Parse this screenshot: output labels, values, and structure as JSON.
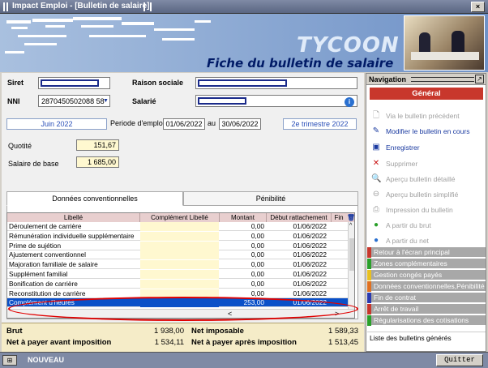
{
  "window": {
    "title": "Impact Emploi - [Bulletin de salaire]"
  },
  "banner": {
    "brand": "TYCOON",
    "heading": "Fiche du bulletin de salaire"
  },
  "form": {
    "siret_label": "Siret",
    "raison_label": "Raison sociale",
    "nni_label": "NNI",
    "nni_value": "2870450502088 58",
    "salarie_label": "Salarié",
    "period_month": "Juin 2022",
    "period_label": "Periode d'emploi",
    "period_start": "01/06/2022",
    "period_au": "au",
    "period_end": "30/06/2022",
    "quarter": "2e trimestre 2022",
    "quotite_label": "Quotité",
    "quotite_value": "151,67",
    "salaire_label": "Salaire de base",
    "salaire_value": "1 685,00"
  },
  "tabs": [
    {
      "label": "Données conventionnelles"
    },
    {
      "label": "Pénibilité"
    }
  ],
  "grid": {
    "headers": [
      "Libellé",
      "Complément Libellé",
      "Montant",
      "Début rattachement",
      "Fin"
    ],
    "rows": [
      {
        "libelle": "Déroulement de carrière",
        "complement": "",
        "montant": "0,00",
        "debut": "01/06/2022"
      },
      {
        "libelle": "Rémunération individuelle supplémentaire",
        "complement": "",
        "montant": "0,00",
        "debut": "01/06/2022"
      },
      {
        "libelle": "Prime de sujétion",
        "complement": "",
        "montant": "0,00",
        "debut": "01/06/2022"
      },
      {
        "libelle": "Ajustement conventionnel",
        "complement": "",
        "montant": "0,00",
        "debut": "01/06/2022"
      },
      {
        "libelle": "Majoration familiale de salaire",
        "complement": "",
        "montant": "0,00",
        "debut": "01/06/2022"
      },
      {
        "libelle": "Supplément familial",
        "complement": "",
        "montant": "0,00",
        "debut": "01/06/2022"
      },
      {
        "libelle": "Bonification de carrière",
        "complement": "",
        "montant": "0,00",
        "debut": "01/06/2022"
      },
      {
        "libelle": "Reconstitution de carrière",
        "complement": "",
        "montant": "0,00",
        "debut": "01/06/2022"
      },
      {
        "libelle": "Complément d'heures",
        "complement": "",
        "montant": "253,00",
        "debut": "01/06/2022"
      }
    ]
  },
  "totals": {
    "brut_label": "Brut",
    "brut_value": "1 938,00",
    "net_imposable_label": "Net imposable",
    "net_imposable_value": "1 589,33",
    "net_avant_label": "Net à payer avant imposition",
    "net_avant_value": "1 534,11",
    "net_apres_label": "Net à payer après imposition",
    "net_apres_value": "1 513,45"
  },
  "navigation": {
    "title": "Navigation",
    "general": "Général",
    "items": [
      {
        "label": "Via le bulletin précédent",
        "icon": "document-icon",
        "enabled": false
      },
      {
        "label": "Modifier le bulletin en cours",
        "icon": "edit-document-icon",
        "enabled": true
      },
      {
        "label": "Enregistrer",
        "icon": "save-icon",
        "enabled": true
      },
      {
        "label": "Supprimer",
        "icon": "delete-icon",
        "enabled": false
      },
      {
        "label": "Aperçu bulletin détaillé",
        "icon": "preview-icon",
        "enabled": false
      },
      {
        "label": "Aperçu bulletin simplifié",
        "icon": "zoom-icon",
        "enabled": false
      },
      {
        "label": "Impression du bulletin",
        "icon": "print-icon",
        "enabled": false
      },
      {
        "label": "A partir du brut",
        "icon": "green-circle-icon",
        "enabled": false
      },
      {
        "label": "A partir du net",
        "icon": "blue-circle-icon",
        "enabled": false
      }
    ],
    "bands": [
      {
        "label": "Retour à l'écran principal",
        "color": "#c8372c"
      },
      {
        "label": "Zones complémentaires",
        "color": "#2aa02a"
      },
      {
        "label": "Gestion congés payés",
        "color": "#e8c020"
      },
      {
        "label": "Données conventionnelles,Pénibilité",
        "color": "#e07020"
      },
      {
        "label": "Fin de contrat",
        "color": "#2a3ab0"
      },
      {
        "label": "Arrêt de travail",
        "color": "#c8372c"
      },
      {
        "label": "Régularisations des cotisations",
        "color": "#2aa02a"
      }
    ],
    "list_label": "Liste des bulletins générés"
  },
  "status": {
    "mode": "NOUVEAU",
    "quit": "Quitter"
  }
}
